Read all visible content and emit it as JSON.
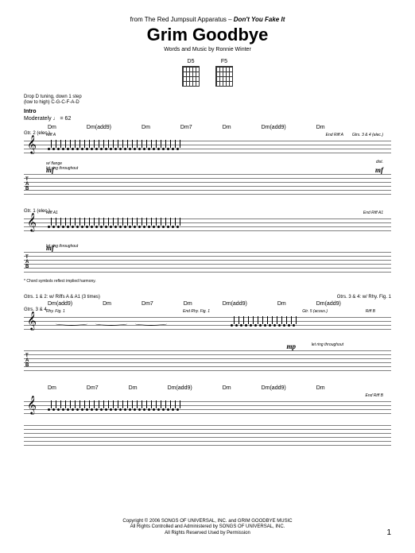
{
  "header": {
    "from_prefix": "from The Red Jumpsuit Apparatus – ",
    "album": "Don't You Fake It",
    "title": "Grim Goodbye",
    "credits": "Words and Music by Ronnie Winter"
  },
  "chord_diagrams": [
    {
      "name": "D5"
    },
    {
      "name": "F5"
    }
  ],
  "tuning": {
    "line1": "Drop D tuning, down 1 step",
    "line2": "(low to high) C-G-C-F-A-D"
  },
  "intro": {
    "section": "Intro",
    "tempo": "Moderately ♩ = 62"
  },
  "systems": [
    {
      "chords": [
        "Dm",
        "Dm(add9)",
        "Dm",
        "Dm7",
        "Dm",
        "Dm(add9)",
        "Dm"
      ],
      "gtr_label": "Gtr. 2 (elec.)",
      "riff_label": "Riff A",
      "end_label": "End Riff A",
      "dynamic": "mf",
      "perf1": "w/ flange",
      "perf2": "let ring throughout",
      "gtrs_label": "Gtrs. 3 & 4 (elec.)",
      "dist": "dist.",
      "dynamic2": "mf"
    },
    {
      "gtr_label": "Gtr. 1 (elec.)",
      "riff_label": "Riff A1",
      "end_label": "End Riff A1",
      "dynamic": "mf",
      "perf": "let ring throughout"
    },
    {
      "footnote": "* Chord symbols reflect implied harmony.",
      "header_left": "Gtrs. 1 & 2: w/ Riffs A & A1 (3 times)",
      "header_right": "Gtrs. 3 & 4: w/ Rhy. Fig. 1",
      "chords": [
        "Dm(add9)",
        "Dm",
        "Dm7",
        "Dm",
        "Dm(add9)",
        "Dm",
        "Dm(add9)"
      ],
      "gtr_label": "Gtrs. 3 & 4",
      "rhy_label": "Rhy. Fig. 1",
      "end_label": "End Rhy. Fig. 1",
      "gtr5": "Gtr. 5 (acous.)",
      "riff_b": "Riff B",
      "dynamic": "mp",
      "perf": "let ring throughout"
    },
    {
      "chords": [
        "Dm",
        "Dm7",
        "Dm",
        "Dm(add9)",
        "Dm",
        "Dm(add9)",
        "Dm"
      ],
      "end_label": "End Riff B"
    }
  ],
  "copyright": {
    "line1": "Copyright © 2006 SONGS OF UNIVERSAL, INC. and GRIM GOODBYE MUSIC",
    "line2": "All Rights Controlled and Administered by SONGS OF UNIVERSAL, INC.",
    "line3": "All Rights Reserved   Used by Permission"
  },
  "page_number": "1"
}
